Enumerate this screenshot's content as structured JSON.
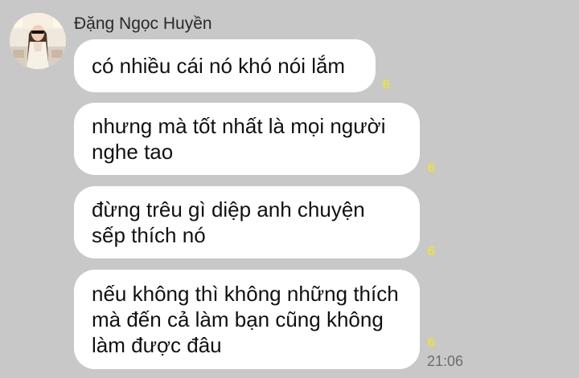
{
  "sender": {
    "name": "Đặng Ngọc Huyền"
  },
  "messages": [
    {
      "text": "có nhiều cái nó khó nói lắm",
      "read_count": "6"
    },
    {
      "text": "nhưng mà tốt nhất là mọi người nghe tao",
      "read_count": "6"
    },
    {
      "text": "đừng trêu gì diệp anh chuyện sếp thích nó",
      "read_count": "6"
    },
    {
      "text": "nếu không thì không những thích mà đến cả làm bạn cũng không làm được đâu",
      "read_count": "6"
    }
  ],
  "last_timestamp": "21:06",
  "colors": {
    "background": "#c8c8c8",
    "bubble": "#ffffff",
    "read_count": "#e8df4a",
    "timestamp": "#6d6d6d"
  }
}
